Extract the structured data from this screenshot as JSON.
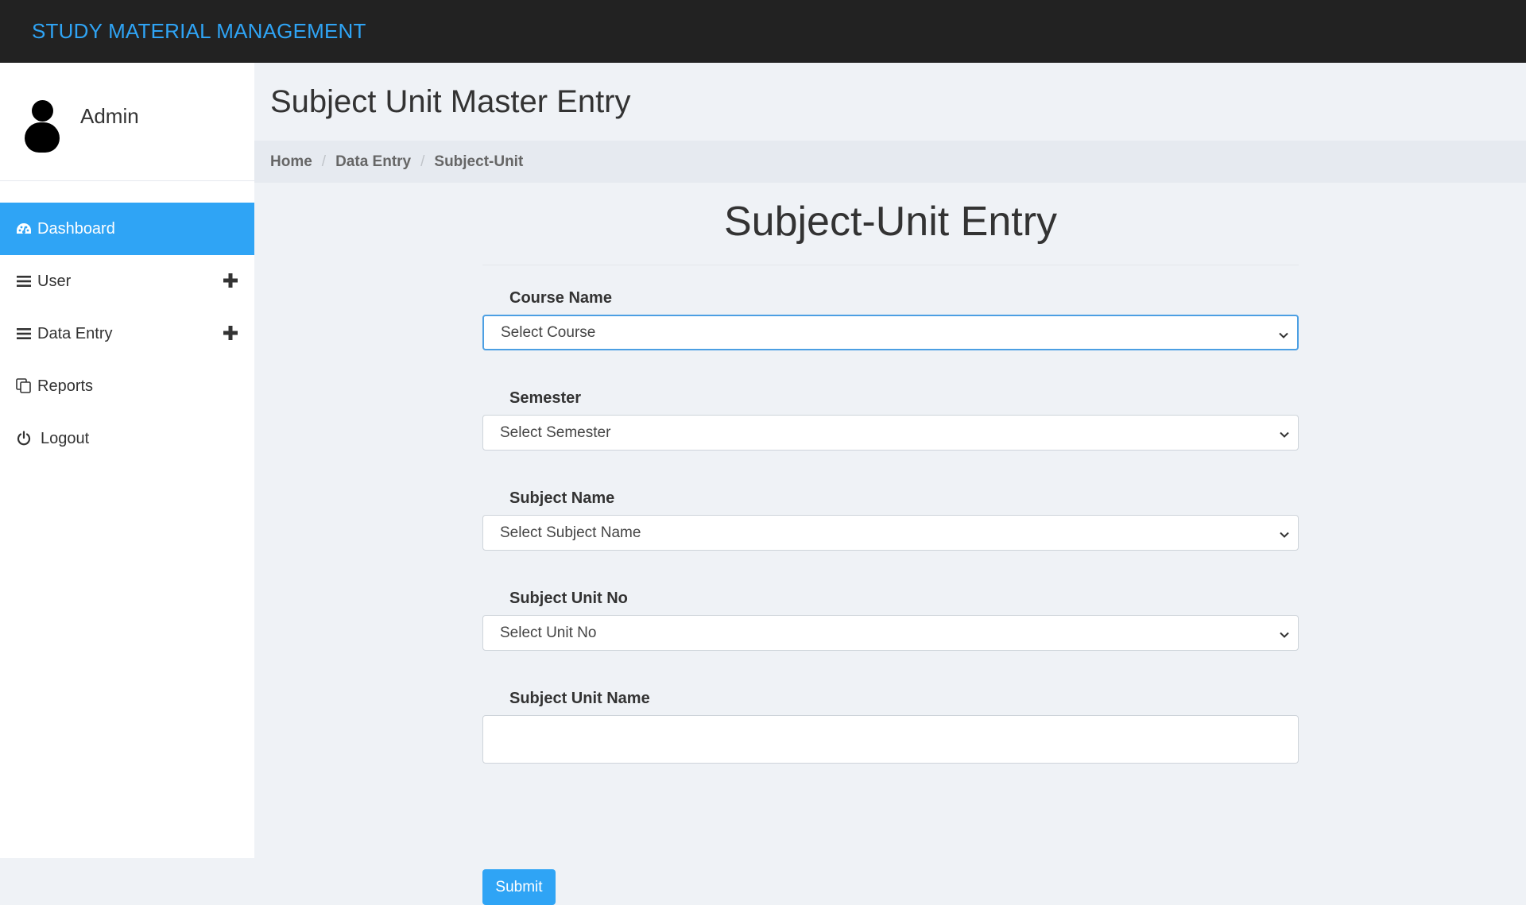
{
  "app": {
    "brand": "STUDY MATERIAL MANAGEMENT"
  },
  "sidebar": {
    "profile_name": "Admin",
    "items": [
      {
        "label": "Dashboard",
        "icon": "dashboard-icon",
        "active": true
      },
      {
        "label": "User",
        "icon": "menu-icon",
        "expandable": true
      },
      {
        "label": "Data Entry",
        "icon": "menu-icon",
        "expandable": true
      },
      {
        "label": "Reports",
        "icon": "copy-icon"
      },
      {
        "label": "Logout",
        "icon": "power-icon"
      }
    ]
  },
  "page": {
    "title": "Subject Unit Master Entry",
    "breadcrumb": [
      "Home",
      "Data Entry",
      "Subject-Unit"
    ]
  },
  "form": {
    "title": "Subject-Unit Entry",
    "fields": [
      {
        "label": "Course Name",
        "value": "Select Course"
      },
      {
        "label": "Semester",
        "value": "Select Semester"
      },
      {
        "label": "Subject Name",
        "value": "Select Subject Name"
      },
      {
        "label": "Subject Unit No",
        "value": "Select Unit No"
      },
      {
        "label": "Subject Unit Name",
        "value": ""
      }
    ],
    "submit_label": "Submit"
  },
  "colors": {
    "accent": "#2fa4f5",
    "topbar": "#222222",
    "background": "#eff2f6"
  }
}
